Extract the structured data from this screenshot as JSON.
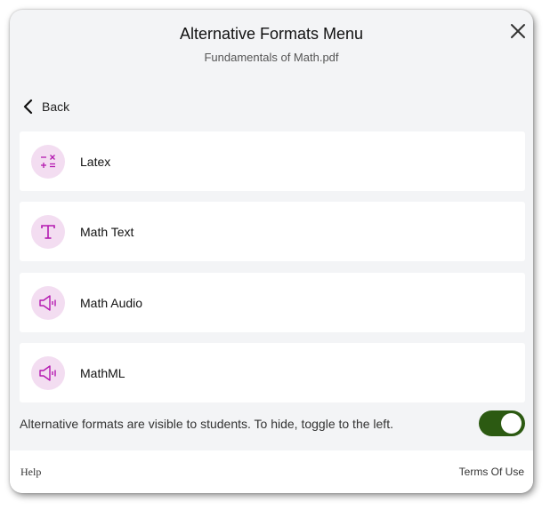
{
  "header": {
    "title": "Alternative Formats Menu",
    "subtitle": "Fundamentals of Math.pdf",
    "close_icon": "close-icon"
  },
  "back": {
    "label": "Back",
    "icon": "chevron-left-icon"
  },
  "formats": [
    {
      "label": "Latex",
      "icon": "math-operators-icon"
    },
    {
      "label": "Math Text",
      "icon": "text-t-icon"
    },
    {
      "label": "Math Audio",
      "icon": "speaker-icon"
    },
    {
      "label": "MathML",
      "icon": "speaker-icon"
    }
  ],
  "visibility": {
    "note": "Alternative formats are visible to students. To hide, toggle to the left.",
    "toggle_on": true
  },
  "footer": {
    "help_label": "Help",
    "terms_label": "Terms Of Use"
  },
  "colors": {
    "icon_accent": "#b41ab0",
    "icon_bg": "#f3ddf1",
    "toggle_on": "#2c5a12",
    "panel_bg": "#f3f4f6"
  }
}
